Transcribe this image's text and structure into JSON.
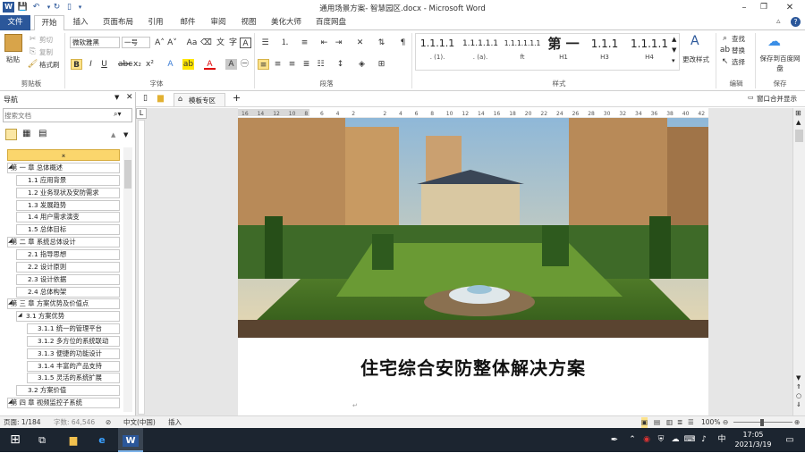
{
  "window": {
    "title": "通用场景方案- 智慧园区.docx - Microsoft Word"
  },
  "tabs": [
    "文件",
    "开始",
    "插入",
    "页面布局",
    "引用",
    "邮件",
    "审阅",
    "视图",
    "美化大师",
    "百度网盘"
  ],
  "ribbon": {
    "clipboard": {
      "paste": "粘贴",
      "cut": "剪切",
      "copy": "复制",
      "format_painter": "格式刷",
      "label": "剪贴板"
    },
    "font": {
      "name": "微软雅黑",
      "size": "一号",
      "label": "字体"
    },
    "paragraph": {
      "label": "段落"
    },
    "styles": {
      "label": "样式",
      "items": [
        {
          "preview": "1.1.1.1",
          "name": ". (1)."
        },
        {
          "preview": "1.1.1.1.1",
          "name": ". (a)."
        },
        {
          "preview": "1.1.1.1.1.1",
          "name": "ft"
        },
        {
          "preview": "第 一",
          "name": "H1"
        },
        {
          "preview": "1.1.1",
          "name": "H3"
        },
        {
          "preview": "1.1.1.1",
          "name": "H4"
        }
      ],
      "change_styles": "更改样式"
    },
    "editing": {
      "find": "查找",
      "replace": "替换",
      "select": "选择",
      "label": "编辑"
    },
    "save": {
      "button": "保存到百度网盘",
      "label": "保存"
    }
  },
  "docbar": {
    "tab_label": "模板专区",
    "window_merge": "窗口合并显示"
  },
  "nav": {
    "title": "导航",
    "search_placeholder": "搜索文档",
    "items": [
      {
        "level": 1,
        "text": "第 一 章 总体概述"
      },
      {
        "level": 2,
        "text": "1.1 应用背景"
      },
      {
        "level": 2,
        "text": "1.2 业务现状及安防需求"
      },
      {
        "level": 2,
        "text": "1.3 发展趋势"
      },
      {
        "level": 2,
        "text": "1.4 用户需求演变"
      },
      {
        "level": 2,
        "text": "1.5 总体目标"
      },
      {
        "level": 1,
        "text": "第 二 章 系统总体设计"
      },
      {
        "level": 2,
        "text": "2.1 指导思想"
      },
      {
        "level": 2,
        "text": "2.2 设计原则"
      },
      {
        "level": 2,
        "text": "2.3 设计依据"
      },
      {
        "level": 2,
        "text": "2.4 总体构架"
      },
      {
        "level": 1,
        "text": "第 三 章 方案优势及价值点"
      },
      {
        "level": 2,
        "text": "3.1 方案优势",
        "expand": true
      },
      {
        "level": 3,
        "text": "3.1.1 统一的管理平台"
      },
      {
        "level": 3,
        "text": "3.1.2 多方位的系统联动"
      },
      {
        "level": 3,
        "text": "3.1.3 便捷的功能设计"
      },
      {
        "level": 3,
        "text": "3.1.4 丰富的产品支持"
      },
      {
        "level": 3,
        "text": "3.1.5 灵活的系统扩展"
      },
      {
        "level": 2,
        "text": "3.2 方案价值"
      },
      {
        "level": 1,
        "text": "第 四 章 视频监控子系统"
      }
    ]
  },
  "ruler": {
    "ticks": [
      "16",
      "14",
      "12",
      "10",
      "8",
      "6",
      "4",
      "2",
      "",
      "2",
      "4",
      "6",
      "8",
      "10",
      "12",
      "14",
      "16",
      "18",
      "20",
      "22",
      "24",
      "26",
      "28",
      "30",
      "32",
      "34",
      "36",
      "38",
      "40",
      "42"
    ]
  },
  "document": {
    "title": "住宅综合安防整体解决方案"
  },
  "status": {
    "page": "页面: 1/184",
    "words": "字数: 64,546",
    "lang": "中文(中国)",
    "mode": "插入",
    "zoom": "100%"
  },
  "taskbar": {
    "time": "17:05",
    "date": "2021/3/19",
    "ime": "中"
  }
}
